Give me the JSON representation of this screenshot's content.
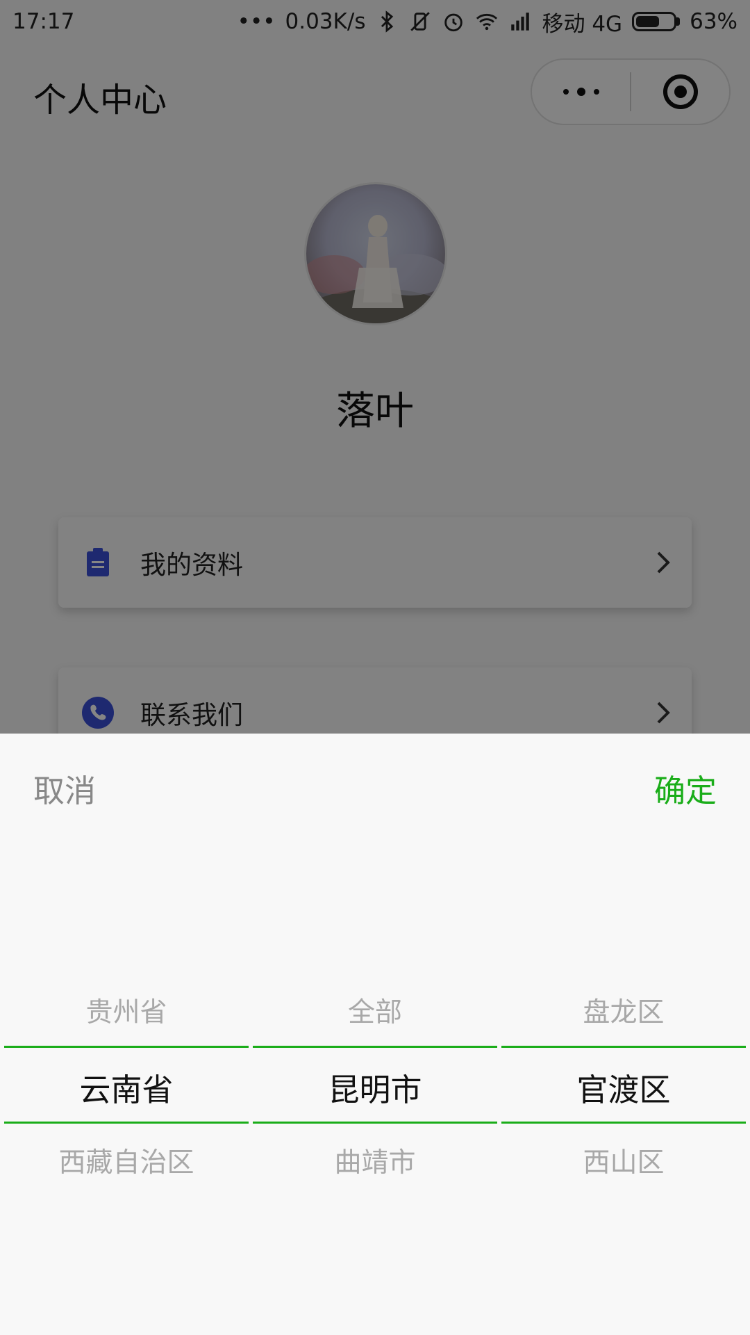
{
  "status_bar": {
    "time": "17:17",
    "network_speed": "0.03K/s",
    "carrier": "移动 4G",
    "battery_percent": "63%",
    "battery_level": 0.63
  },
  "navbar": {
    "title": "个人中心"
  },
  "profile": {
    "nickname": "落叶"
  },
  "menu": [
    {
      "label": "我的资料",
      "icon": "clipboard-icon"
    },
    {
      "label": "联系我们",
      "icon": "phone-icon"
    }
  ],
  "picker": {
    "cancel_label": "取消",
    "confirm_label": "确定",
    "accent_color": "#1aad19",
    "columns": [
      {
        "prev": "贵州省",
        "selected": "云南省",
        "next": "西藏自治区"
      },
      {
        "prev": "全部",
        "selected": "昆明市",
        "next": "曲靖市"
      },
      {
        "prev": "盘龙区",
        "selected": "官渡区",
        "next": "西山区"
      }
    ]
  }
}
